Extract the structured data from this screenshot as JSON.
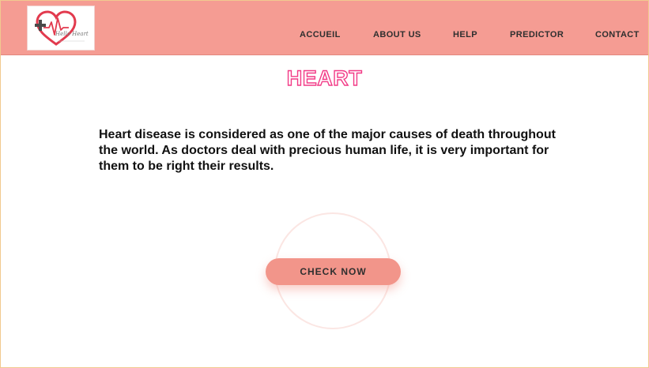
{
  "header": {
    "logo_text": "Hello Heart",
    "nav_items": [
      {
        "label": "ACCUEIL"
      },
      {
        "label": "ABOUT US"
      },
      {
        "label": "HELP"
      },
      {
        "label": "PREDICTOR"
      },
      {
        "label": "CONTACT"
      }
    ]
  },
  "main": {
    "title": "HEART",
    "description": "Heart disease is considered as one of the major causes of death throughout the world. As doctors deal with precious human life, it is very important for them to be right their results.",
    "cta_label": "CHECK NOW"
  },
  "icons": {
    "logo": "heart-pulse-cross-icon"
  },
  "colors": {
    "navbar": "#f59c93",
    "title_outline": "#f23a86",
    "button": "#f2958a",
    "logo_heart": "#e23a4e",
    "logo_cross": "#4a4a4a"
  }
}
